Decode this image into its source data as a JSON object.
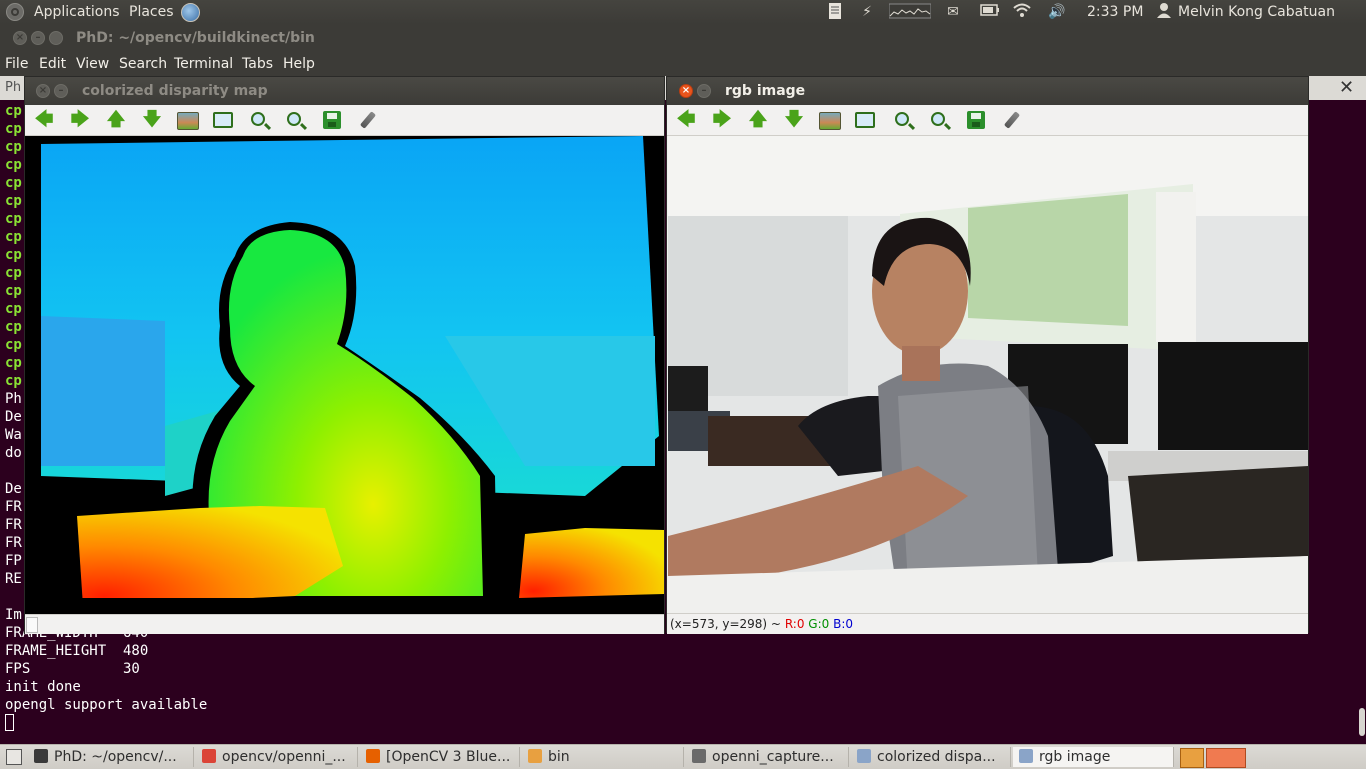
{
  "top_panel": {
    "applications_label": "Applications",
    "places_label": "Places",
    "time": "2:33 PM",
    "user_name": "Melvin Kong Cabatuan"
  },
  "terminal": {
    "title": "PhD: ~/opencv/buildkinect/bin",
    "menu": [
      "File",
      "Edit",
      "View",
      "Search",
      "Terminal",
      "Tabs",
      "Help"
    ],
    "tab_fragment": "Ph",
    "lines": [
      {
        "text": "cp",
        "style": "green"
      },
      {
        "text": "cp",
        "style": "green"
      },
      {
        "text": "cp",
        "style": "green"
      },
      {
        "text": "cp",
        "style": "green"
      },
      {
        "text": "cp",
        "style": "green"
      },
      {
        "text": "cp",
        "style": "green"
      },
      {
        "text": "cp",
        "style": "green"
      },
      {
        "text": "cp",
        "style": "green"
      },
      {
        "text": "cp",
        "style": "green"
      },
      {
        "text": "cp",
        "style": "green"
      },
      {
        "text": "cp",
        "style": "green"
      },
      {
        "text": "cp",
        "style": "green"
      },
      {
        "text": "cp",
        "style": "green"
      },
      {
        "text": "cp",
        "style": "green"
      },
      {
        "text": "cp",
        "style": "green"
      },
      {
        "text": "cp",
        "style": "green"
      },
      {
        "text": "Ph",
        "style": "normal"
      },
      {
        "text": "De",
        "style": "normal"
      },
      {
        "text": "Wa",
        "style": "normal"
      },
      {
        "text": "do",
        "style": "normal"
      },
      {
        "text": "",
        "style": "normal"
      },
      {
        "text": "De",
        "style": "normal"
      },
      {
        "text": "FR",
        "style": "normal"
      },
      {
        "text": "FR",
        "style": "normal"
      },
      {
        "text": "FR",
        "style": "normal"
      },
      {
        "text": "FP",
        "style": "normal"
      },
      {
        "text": "RE",
        "style": "normal"
      },
      {
        "text": "",
        "style": "normal"
      },
      {
        "text": "Im",
        "style": "normal"
      },
      {
        "text": "FRAME_WIDTH   640",
        "style": "normal"
      },
      {
        "text": "FRAME_HEIGHT  480",
        "style": "normal"
      },
      {
        "text": "FPS           30",
        "style": "normal"
      },
      {
        "text": "init done",
        "style": "normal"
      },
      {
        "text": "opengl support available",
        "style": "normal"
      }
    ]
  },
  "disparity_window": {
    "title": "colorized disparity map"
  },
  "rgb_window": {
    "title": "rgb image",
    "status_coords": "(x=573, y=298) ~",
    "status_r": "R:0",
    "status_g": "G:0",
    "status_b": "B:0"
  },
  "taskbar": {
    "items": [
      {
        "label": "PhD: ~/opencv/...",
        "icon": "terminal-icon",
        "active": false
      },
      {
        "label": "opencv/openni_...",
        "icon": "chrome-icon",
        "active": false
      },
      {
        "label": "[OpenCV 3 Blue...",
        "icon": "firefox-icon",
        "active": false
      },
      {
        "label": "bin",
        "icon": "folder-icon",
        "active": false
      },
      {
        "label": "openni_capture...",
        "icon": "text-editor-icon",
        "active": false
      },
      {
        "label": "colorized dispa...",
        "icon": "window-icon",
        "active": false
      },
      {
        "label": "rgb image",
        "icon": "window-icon",
        "active": true
      }
    ]
  },
  "colors": {
    "terminal_bg": "#2c001e",
    "terminal_green": "#8ae234",
    "panel_bg": "#3c3b37",
    "close_orange": "#e9541c"
  }
}
